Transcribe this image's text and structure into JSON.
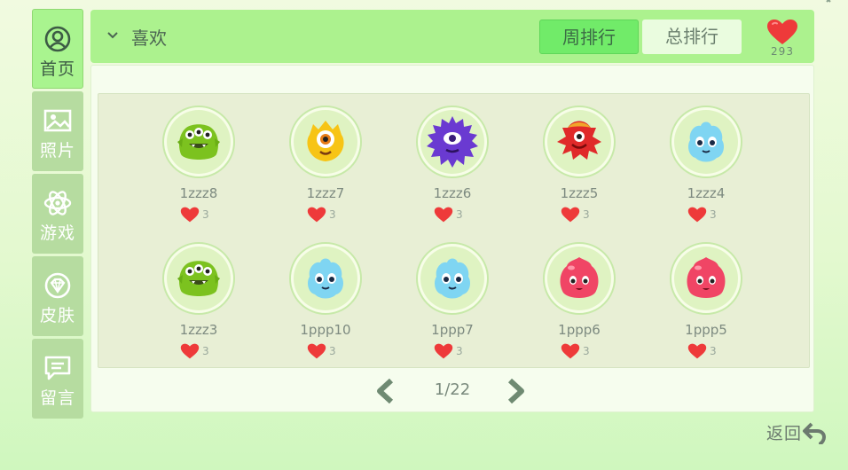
{
  "sidebar": {
    "items": [
      {
        "label": "首页",
        "icon": "user-circle-icon",
        "active": true
      },
      {
        "label": "照片",
        "icon": "photo-icon",
        "active": false
      },
      {
        "label": "游戏",
        "icon": "atom-icon",
        "active": false
      },
      {
        "label": "皮肤",
        "icon": "diamond-badge-icon",
        "active": false
      },
      {
        "label": "留言",
        "icon": "message-icon",
        "active": false
      }
    ]
  },
  "header": {
    "dropdown_label": "喜欢",
    "tabs": [
      {
        "label": "周排行",
        "active": true
      },
      {
        "label": "总排行",
        "active": false
      }
    ],
    "total_likes": "293"
  },
  "users": [
    {
      "name": "1zzz8",
      "likes": "3",
      "avatar": "green-three-eyed-monster"
    },
    {
      "name": "1zzz7",
      "likes": "3",
      "avatar": "yellow-one-eyed-monster"
    },
    {
      "name": "1zzz6",
      "likes": "3",
      "avatar": "purple-spiky-monster"
    },
    {
      "name": "1zzz5",
      "likes": "3",
      "avatar": "red-horned-monster"
    },
    {
      "name": "1zzz4",
      "likes": "3",
      "avatar": "blue-fluffy-monster"
    },
    {
      "name": "1zzz3",
      "likes": "3",
      "avatar": "green-three-eyed-monster"
    },
    {
      "name": "1ppp10",
      "likes": "3",
      "avatar": "blue-fluffy-monster"
    },
    {
      "name": "1ppp7",
      "likes": "3",
      "avatar": "blue-fluffy-monster"
    },
    {
      "name": "1ppp6",
      "likes": "3",
      "avatar": "pink-blob-monster"
    },
    {
      "name": "1ppp5",
      "likes": "3",
      "avatar": "pink-blob-monster"
    }
  ],
  "pagination": {
    "text": "1/22"
  },
  "footer": {
    "back_label": "返回"
  },
  "colors": {
    "accent_green": "#acf28e",
    "active_tab": "#71eb69",
    "heart": "#ee3a3a"
  }
}
